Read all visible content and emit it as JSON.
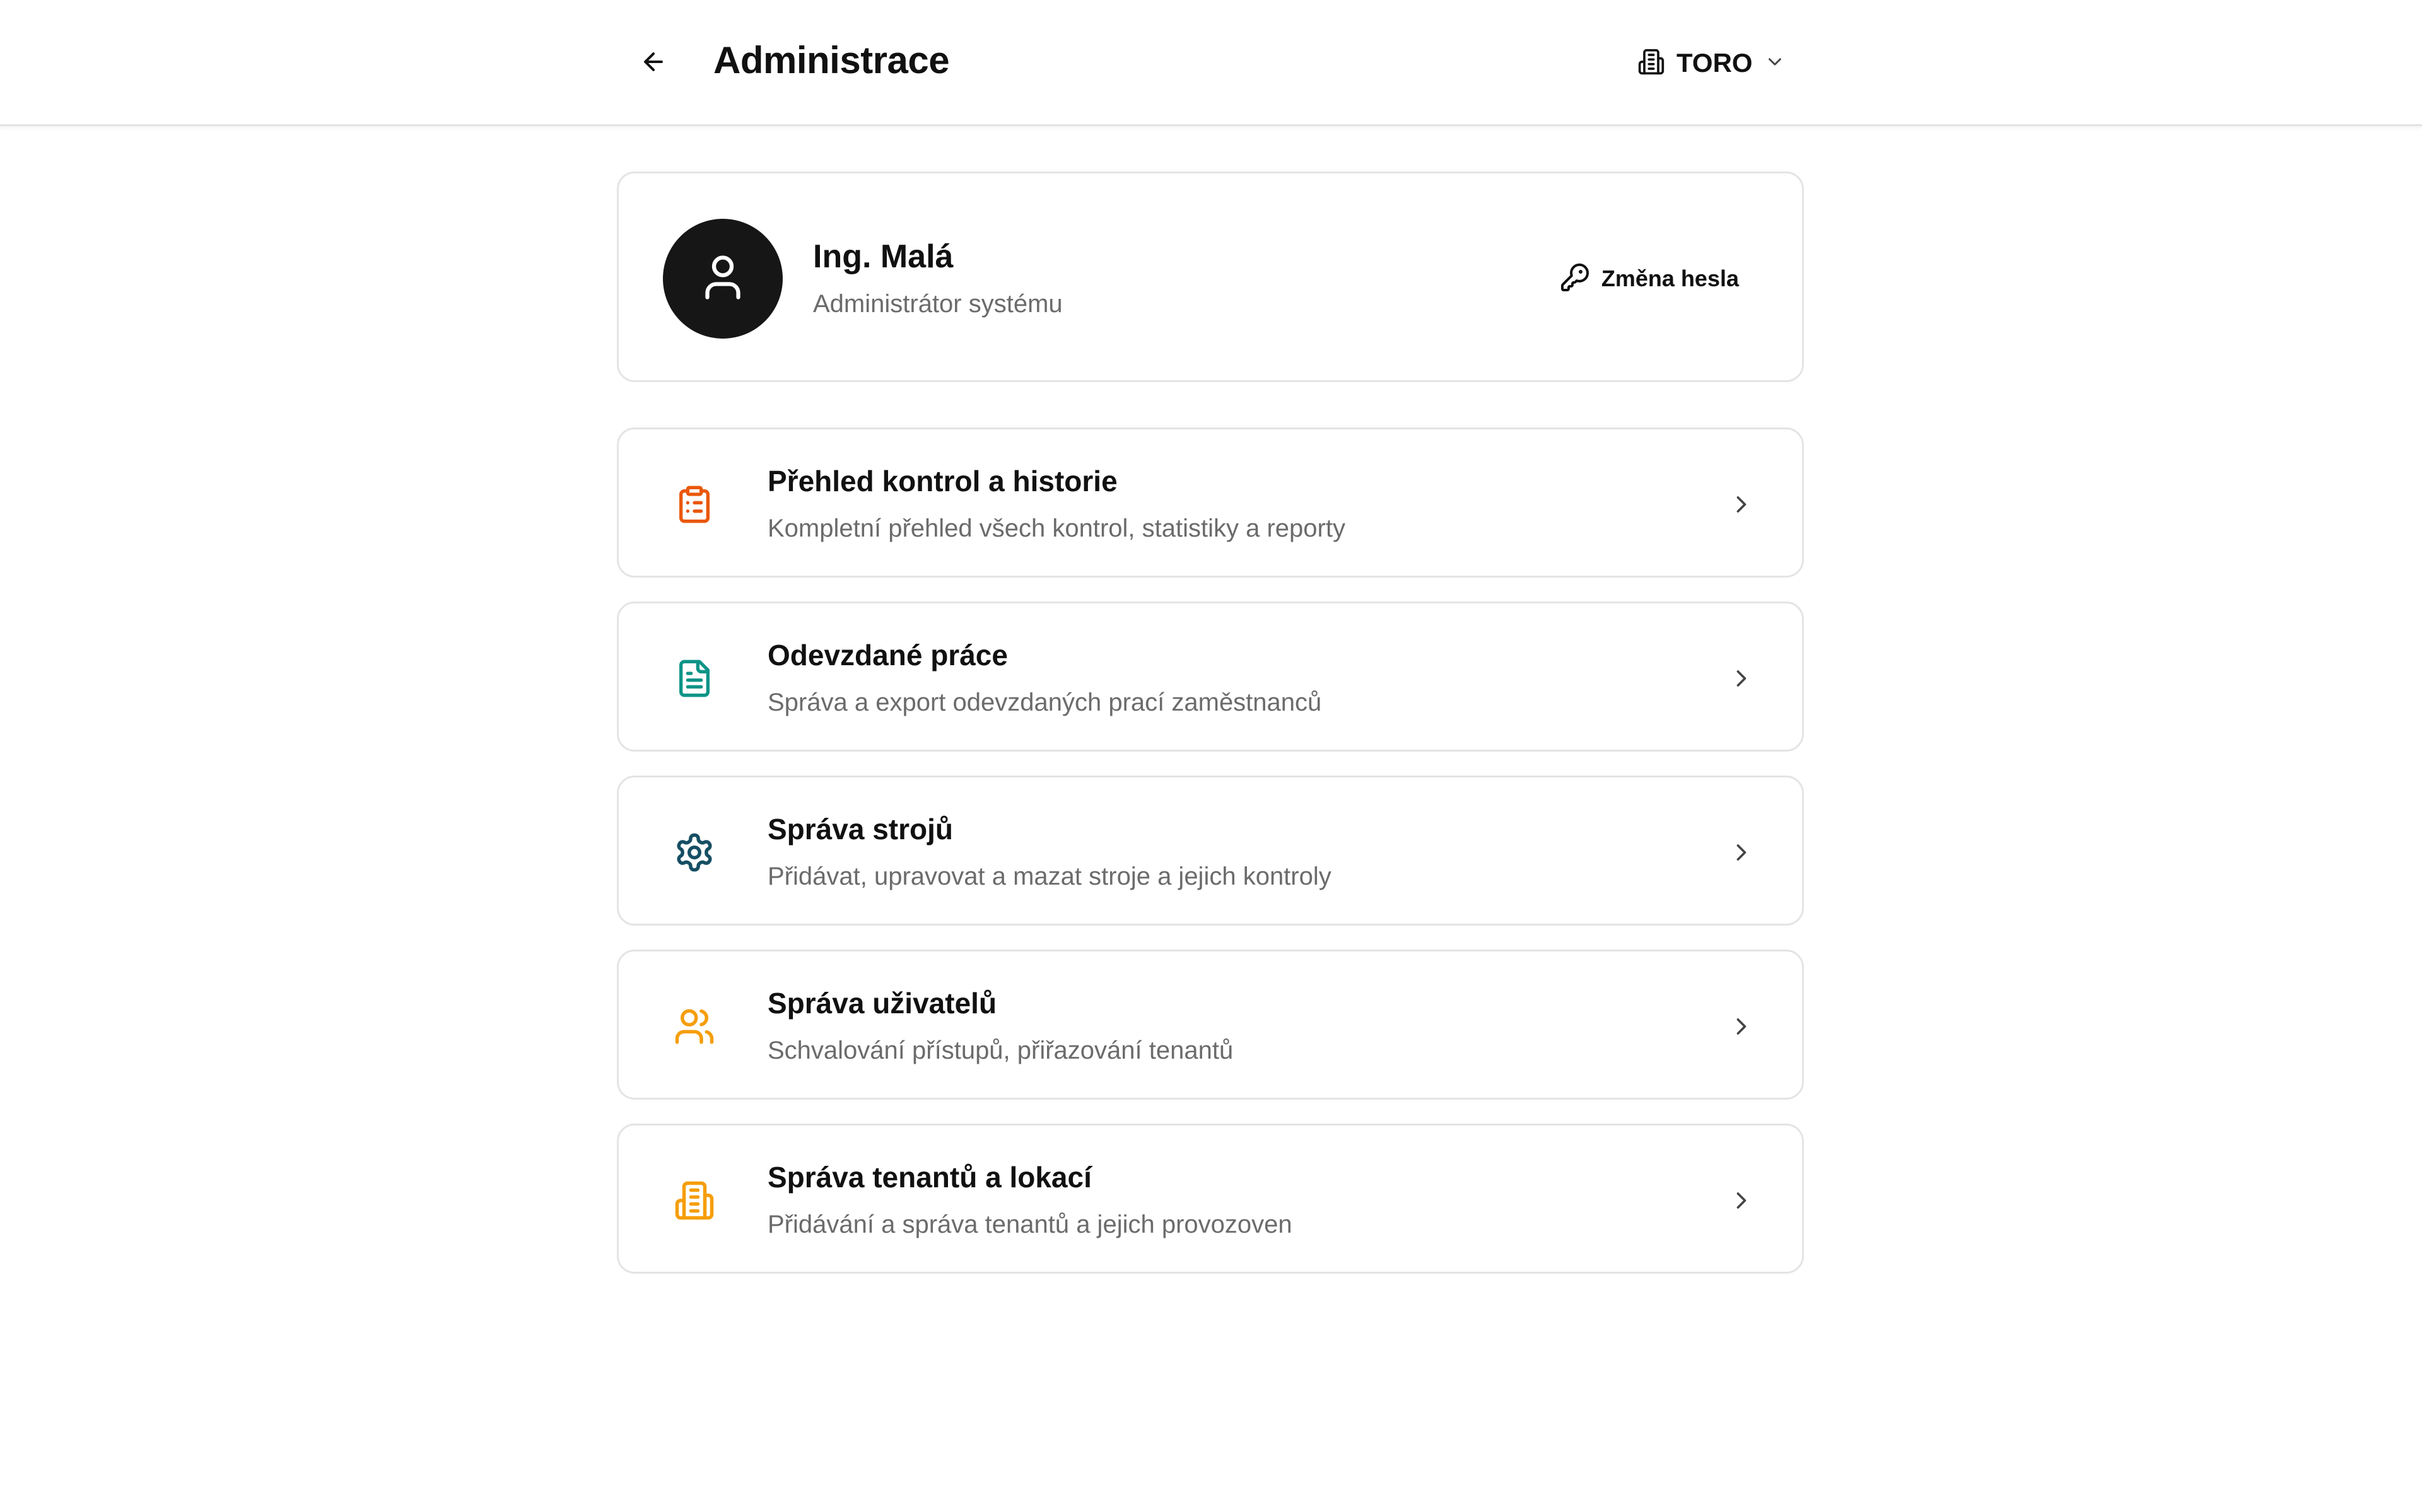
{
  "header": {
    "title": "Administrace",
    "back_icon": "arrow-left-icon",
    "tenant": {
      "name": "TORO",
      "icon": "building-icon",
      "chevron": "chevron-down-icon"
    }
  },
  "profile": {
    "name": "Ing. Malá",
    "role": "Administrátor systému",
    "avatar_icon": "user-icon",
    "change_password_label": "Změna hesla",
    "change_password_icon": "key-icon"
  },
  "menu": [
    {
      "title": "Přehled kontrol a historie",
      "description": "Kompletní přehled všech kontrol, statistiky a reporty",
      "icon": "clipboard-list-icon",
      "color": "#ea580c"
    },
    {
      "title": "Odevzdané práce",
      "description": "Správa a export odevzdaných prací zaměstnanců",
      "icon": "file-text-icon",
      "color": "#0d9488"
    },
    {
      "title": "Správa strojů",
      "description": "Přidávat, upravovat a mazat stroje a jejich kontroly",
      "icon": "gear-icon",
      "color": "#164e63"
    },
    {
      "title": "Správa uživatelů",
      "description": "Schvalování přístupů, přiřazování tenantů",
      "icon": "users-icon",
      "color": "#f59e0b"
    },
    {
      "title": "Správa tenantů a lokací",
      "description": "Přidávání a správa tenantů a jejich provozoven",
      "icon": "building-icon",
      "color": "#f59e0b"
    }
  ]
}
